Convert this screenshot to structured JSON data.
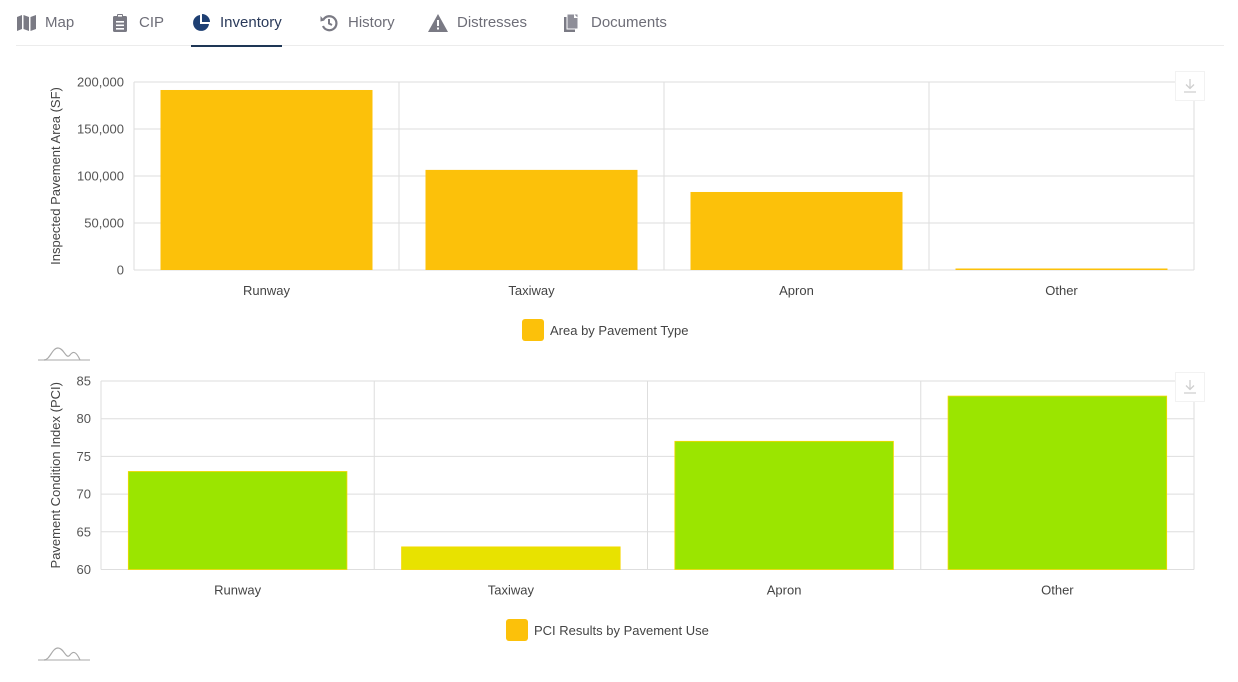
{
  "tabs": [
    {
      "label": "Map",
      "icon": "map-icon",
      "active": false
    },
    {
      "label": "CIP",
      "icon": "clipboard-icon",
      "active": false
    },
    {
      "label": "Inventory",
      "icon": "pie-chart-icon",
      "active": true
    },
    {
      "label": "History",
      "icon": "history-icon",
      "active": false
    },
    {
      "label": "Distresses",
      "icon": "warning-icon",
      "active": false
    },
    {
      "label": "Documents",
      "icon": "documents-icon",
      "active": false
    }
  ],
  "colors": {
    "bar_area": "#fcc10a",
    "bar_pci_good": "#9be500",
    "bar_pci_fair": "#e8e200",
    "active_tab": "#1e3655",
    "grid": "#dddddd"
  },
  "chart_data": [
    {
      "type": "bar",
      "title": "",
      "categories": [
        "Runway",
        "Taxiway",
        "Apron",
        "Other"
      ],
      "values": [
        191500,
        106500,
        83000,
        1500
      ],
      "ylabel": "Inspected Pavement Area (SF)",
      "xlabel": "",
      "ylim": [
        0,
        200000
      ],
      "yticks": [
        0,
        50000,
        100000,
        150000,
        200000
      ],
      "ytick_labels": [
        "0",
        "50,000",
        "100,000",
        "150,000",
        "200,000"
      ],
      "legend": {
        "label": "Area by Pavement Type",
        "placement": "bottom-center"
      },
      "bar_colors": [
        "#fcc10a",
        "#fcc10a",
        "#fcc10a",
        "#fcc10a"
      ],
      "grid": true
    },
    {
      "type": "bar",
      "title": "",
      "categories": [
        "Runway",
        "Taxiway",
        "Apron",
        "Other"
      ],
      "values": [
        73,
        63,
        77,
        83
      ],
      "ylabel": "Pavement Condition Index (PCI)",
      "xlabel": "",
      "ylim": [
        60,
        85
      ],
      "yticks": [
        60,
        65,
        70,
        75,
        80,
        85
      ],
      "ytick_labels": [
        "60",
        "65",
        "70",
        "75",
        "80",
        "85"
      ],
      "legend": {
        "label": "PCI Results by Pavement Use",
        "placement": "bottom-center"
      },
      "bar_colors": [
        "#9be500",
        "#e8e200",
        "#9be500",
        "#9be500"
      ],
      "grid": true
    }
  ]
}
